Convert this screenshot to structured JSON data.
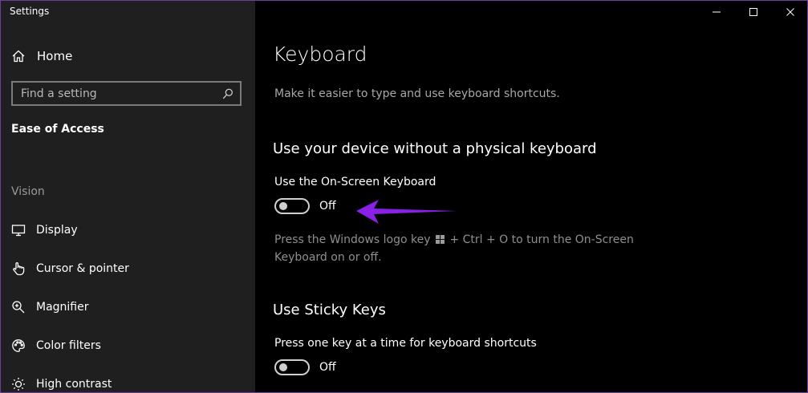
{
  "window": {
    "title": "Settings",
    "accent_color": "#6b3fa0"
  },
  "sidebar": {
    "home_label": "Home",
    "search_placeholder": "Find a setting",
    "section_title": "Ease of Access",
    "group_label": "Vision",
    "items": [
      {
        "label": "Display",
        "icon": "monitor-icon"
      },
      {
        "label": "Cursor & pointer",
        "icon": "pointer-hand-icon"
      },
      {
        "label": "Magnifier",
        "icon": "magnifier-icon"
      },
      {
        "label": "Color filters",
        "icon": "palette-icon"
      },
      {
        "label": "High contrast",
        "icon": "sun-icon"
      }
    ]
  },
  "content": {
    "title": "Keyboard",
    "description": "Make it easier to type and use keyboard shortcuts.",
    "sections": [
      {
        "heading": "Use your device without a physical keyboard",
        "setting_label": "Use the On-Screen Keyboard",
        "toggle_state": "Off",
        "help_before_icon": "Press the Windows logo key",
        "help_after_icon": "+ Ctrl + O to turn the On-Screen Keyboard on or off."
      },
      {
        "heading": "Use Sticky Keys",
        "setting_label": "Press one key at a time for keyboard shortcuts",
        "toggle_state": "Off"
      }
    ],
    "annotation_arrow_color": "#8a1fe8"
  }
}
